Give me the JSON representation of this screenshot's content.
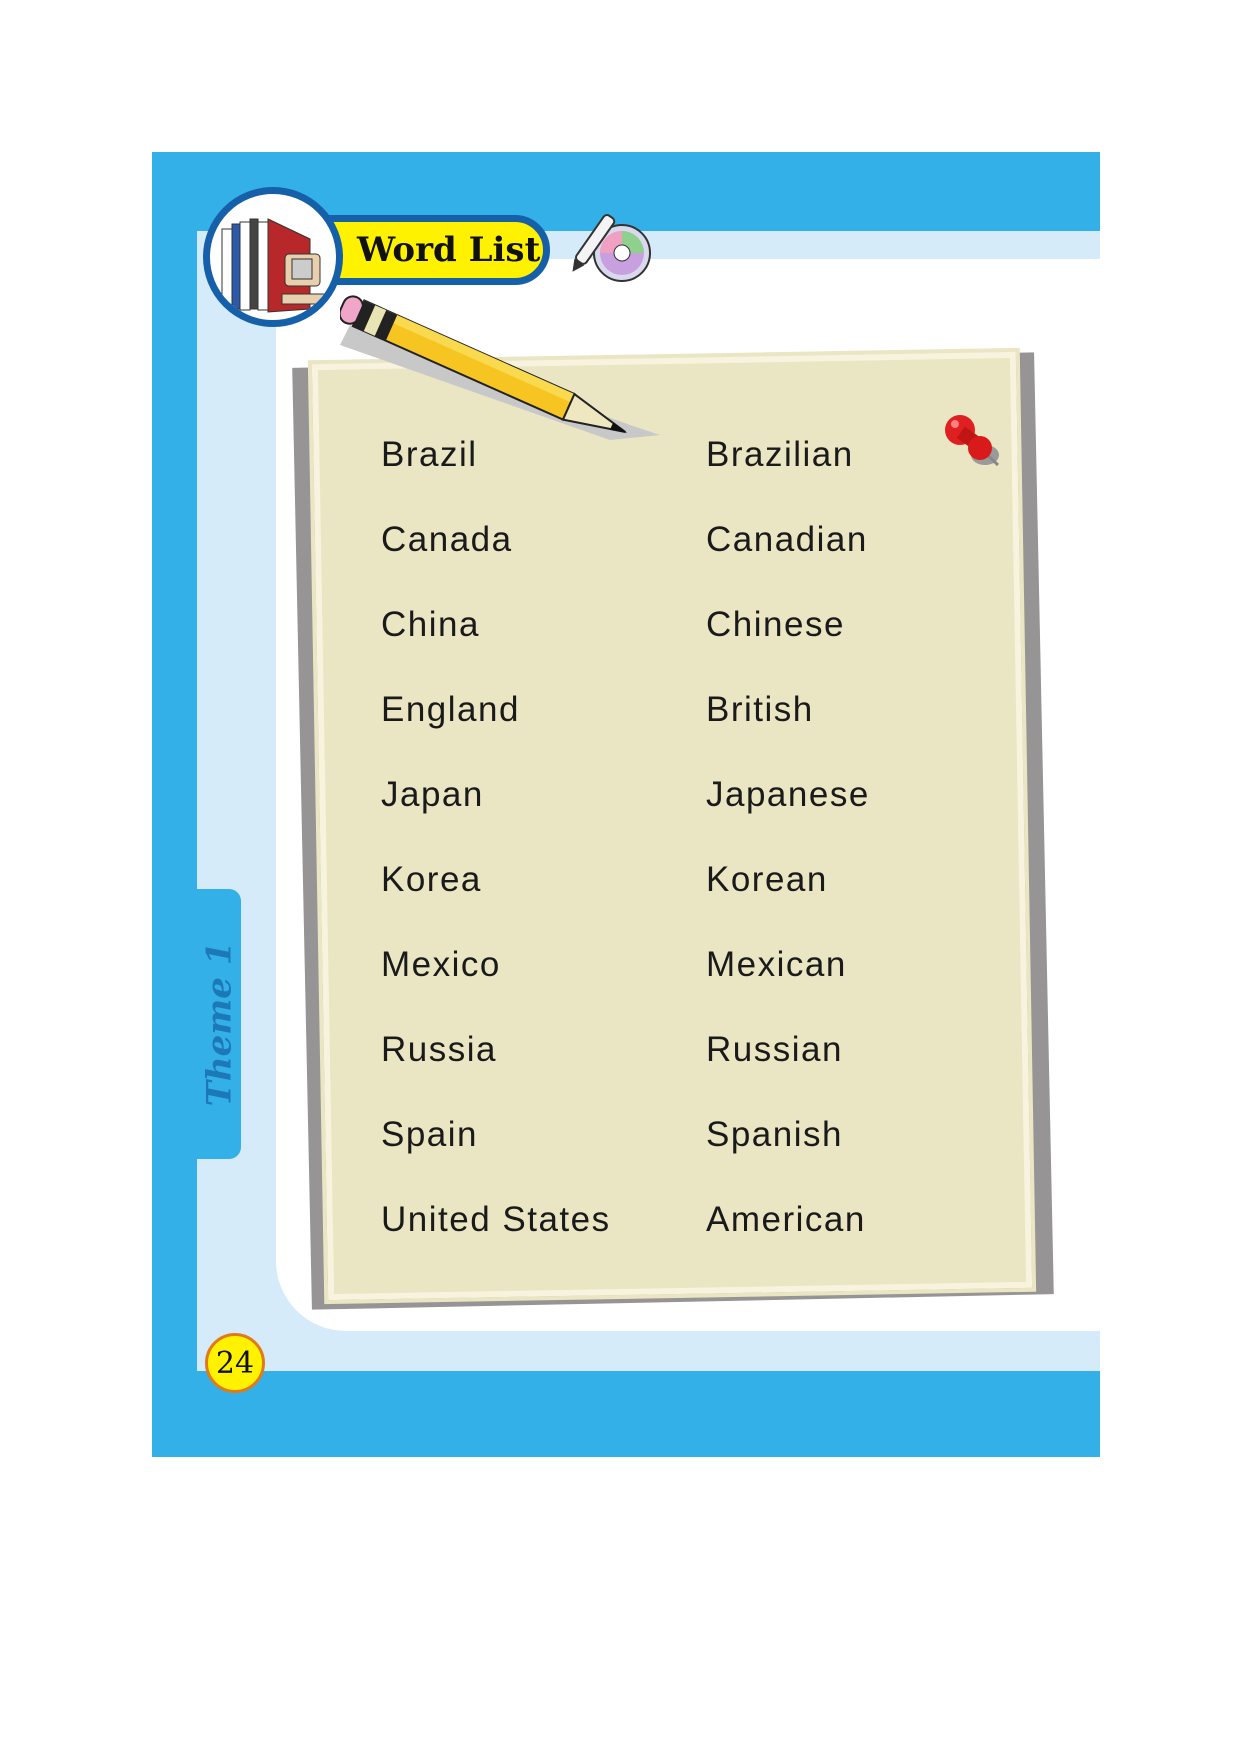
{
  "header": {
    "title": "Word List"
  },
  "sidebar": {
    "theme_label": "Theme 1"
  },
  "footer": {
    "page_number": "24"
  },
  "word_list": [
    {
      "country": "Brazil",
      "nationality": "Brazilian"
    },
    {
      "country": "Canada",
      "nationality": "Canadian"
    },
    {
      "country": "China",
      "nationality": "Chinese"
    },
    {
      "country": "England",
      "nationality": "British"
    },
    {
      "country": "Japan",
      "nationality": "Japanese"
    },
    {
      "country": "Korea",
      "nationality": "Korean"
    },
    {
      "country": "Mexico",
      "nationality": "Mexican"
    },
    {
      "country": "Russia",
      "nationality": "Russian"
    },
    {
      "country": "Spain",
      "nationality": "Spanish"
    },
    {
      "country": "United States",
      "nationality": "American"
    }
  ],
  "colors": {
    "frame": "#33b0e8",
    "light": "#d6ebf9",
    "paper": "#eae5c2",
    "badge": "#fff200",
    "badge_border": "#1560a8"
  }
}
